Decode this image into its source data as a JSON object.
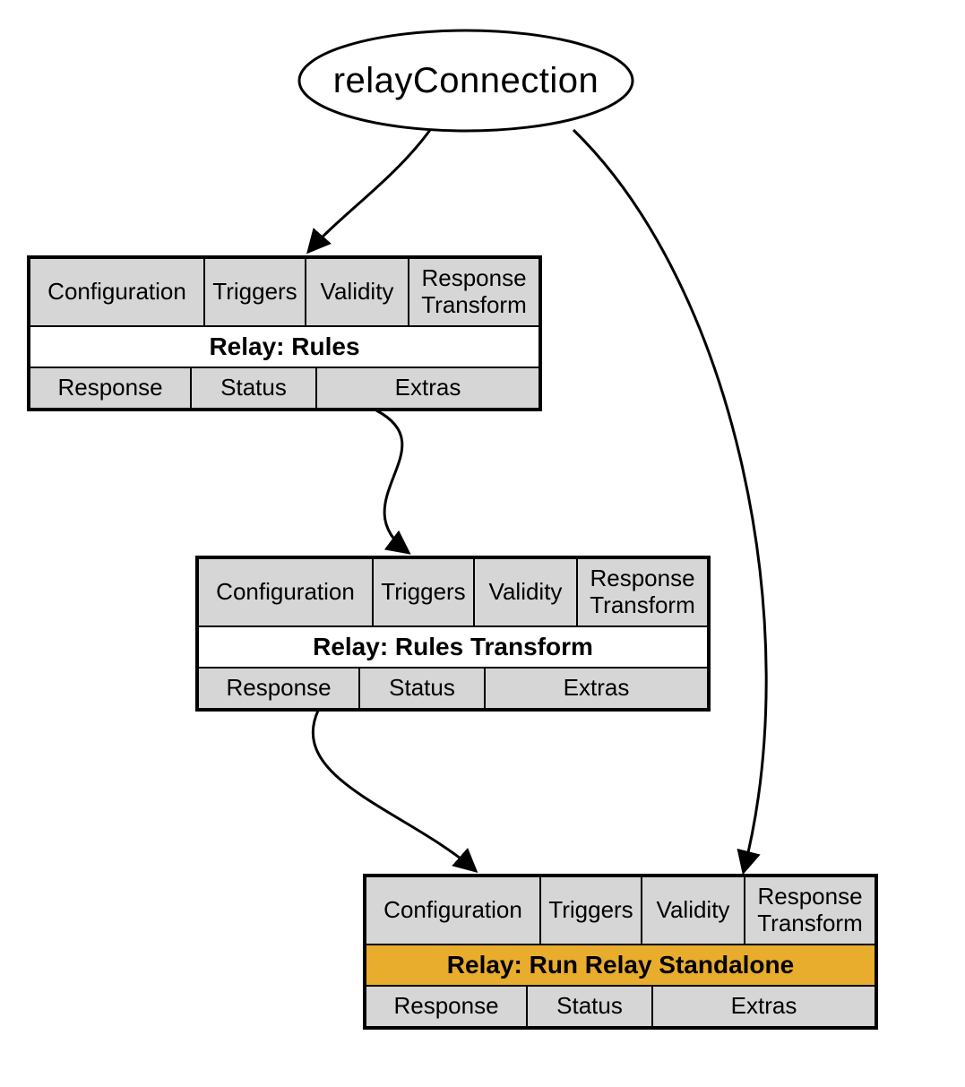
{
  "root": {
    "label": "relayConnection"
  },
  "top_row_labels": {
    "configuration": "Configuration",
    "triggers": "Triggers",
    "validity": "Validity",
    "response_transform": "Response Transform"
  },
  "bottom_row_labels": {
    "response": "Response",
    "status": "Status",
    "extras": "Extras"
  },
  "blocks": [
    {
      "title": "Relay: Rules",
      "highlight": false
    },
    {
      "title": "Relay: Rules Transform",
      "highlight": false
    },
    {
      "title": "Relay: Run Relay Standalone",
      "highlight": true
    }
  ],
  "colors": {
    "cell_bg": "#d6d6d6",
    "highlight_bg": "#e9ad2d",
    "border": "#000000",
    "canvas_bg": "#ffffff"
  },
  "edges": [
    {
      "from": "root",
      "to": "block1"
    },
    {
      "from": "root",
      "to": "block3"
    },
    {
      "from": "block1",
      "to": "block2"
    },
    {
      "from": "block2",
      "to": "block3"
    }
  ]
}
